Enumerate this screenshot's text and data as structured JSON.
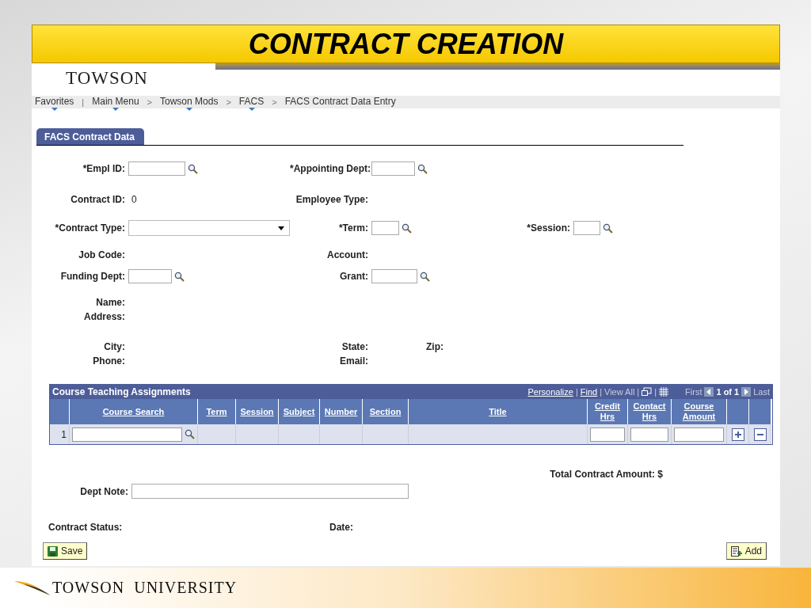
{
  "slide_title": "CONTRACT CREATION",
  "logo": "TOWSON",
  "breadcrumbs": [
    {
      "label": "Favorites",
      "menu": true
    },
    {
      "separator": "|",
      "label": "Main Menu",
      "menu": true
    },
    {
      "separator": ">",
      "label": "Towson Mods",
      "menu": true
    },
    {
      "separator": ">",
      "label": "FACS",
      "menu": true
    },
    {
      "separator": ">",
      "label": "FACS Contract Data Entry",
      "menu": false
    }
  ],
  "tab": {
    "label": "FACS Contract Data",
    "selected": true
  },
  "rows": [
    {
      "col1": {
        "label": "*Empl ID:",
        "kind": "lookup"
      },
      "col2": {
        "label": "*Appointing Dept:",
        "kind": "lookup"
      }
    },
    {
      "col1": {
        "label": "Contract ID:",
        "kind": "display",
        "value": "0"
      },
      "col2": {
        "label": "Employee Type:",
        "kind": "display"
      }
    },
    {
      "col1": {
        "label": "*Contract Type:",
        "kind": "select"
      },
      "col2": {
        "label": "*Term:",
        "kind": "lookup"
      },
      "col3": {
        "label": "*Session:",
        "kind": "lookup"
      }
    },
    {
      "col1": {
        "label": "Job Code:",
        "kind": "display"
      },
      "col2": {
        "label": "Account:",
        "kind": "display"
      }
    },
    {
      "col1": {
        "label": "Funding Dept:",
        "kind": "lookup"
      },
      "col2": {
        "label": "Grant:",
        "kind": "lookup"
      }
    },
    {
      "col1": {
        "label": "Name:",
        "kind": "display"
      }
    },
    {
      "col1": {
        "label": "Address:",
        "kind": "display"
      }
    },
    {
      "col1": {
        "label": "City:",
        "kind": "display"
      },
      "col2": {
        "label": "State:",
        "kind": "display",
        "extra": "Zip:"
      }
    },
    {
      "col1": {
        "label": "Phone:",
        "kind": "display"
      },
      "col2": {
        "label": "Email:",
        "kind": "display"
      }
    }
  ],
  "grid": {
    "title": "Course Teaching Assignments",
    "links": [
      {
        "label": "Personalize",
        "separator": "|"
      },
      {
        "label": "Find",
        "separator": "|"
      }
    ],
    "view_all": {
      "label": "View All",
      "separator": "|"
    },
    "icon_separator": "|",
    "first": "First",
    "count": "1 of 1",
    "last": "Last",
    "columns": [
      {
        "kind": "number"
      },
      {
        "label": "Course Search",
        "kind": "lookup"
      },
      {
        "label": "Term",
        "kind": "text"
      },
      {
        "label": "Session",
        "kind": "text"
      },
      {
        "label": "Subject",
        "kind": "text"
      },
      {
        "label": "Number",
        "kind": "text"
      },
      {
        "label": "Section",
        "kind": "text"
      },
      {
        "label": "Title",
        "kind": "text"
      },
      {
        "label": "Credit Hrs",
        "kind": "input"
      },
      {
        "label": "Contact Hrs",
        "kind": "input"
      },
      {
        "label": "Course Amount",
        "kind": "input"
      },
      {
        "kind": "add"
      },
      {
        "kind": "delete"
      }
    ],
    "rows": [
      {
        "number": "1"
      }
    ]
  },
  "total_label": "Total Contract Amount: $",
  "dept_note_label": "Dept Note:",
  "status_label": "Contract Status:",
  "date_label": "Date:",
  "save_button": "Save",
  "add_button": "Add",
  "footer": "TOWSON  UNIVERSITY"
}
